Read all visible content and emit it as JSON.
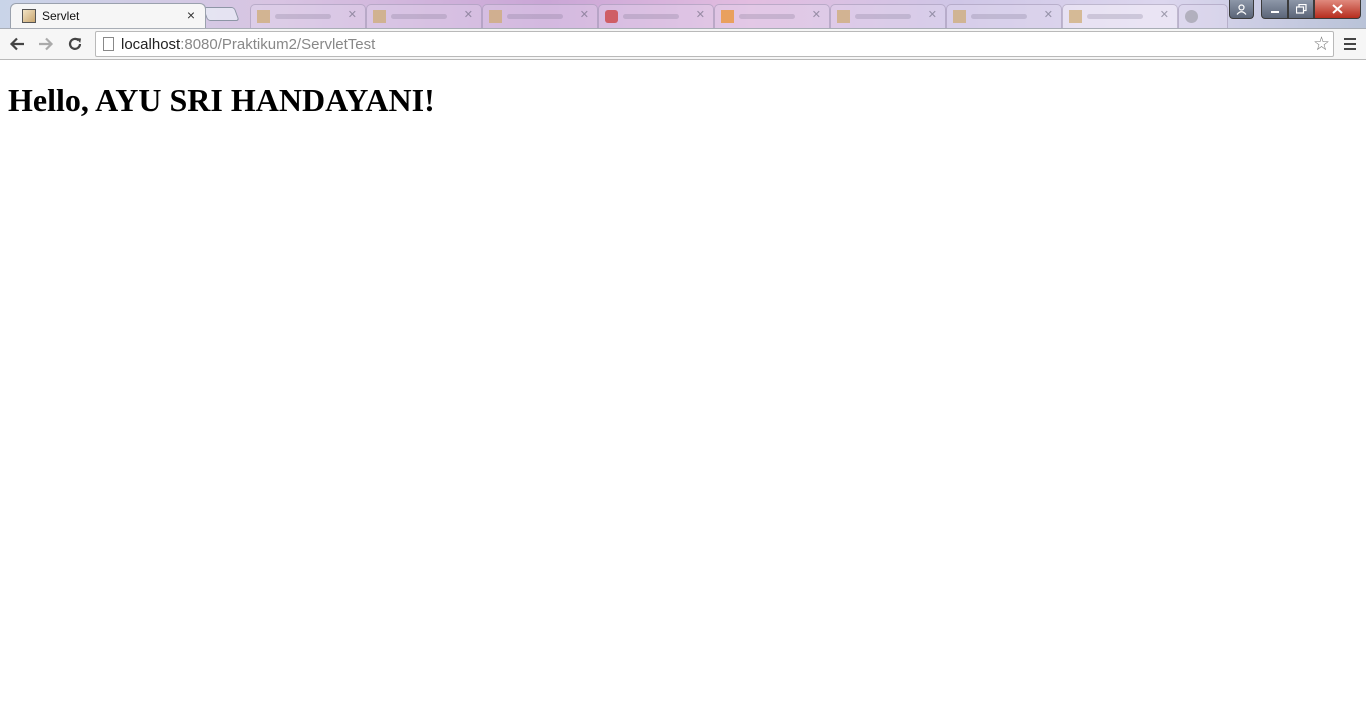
{
  "browser": {
    "active_tab": {
      "title": "Servlet",
      "close_label": "×"
    },
    "address_bar": {
      "host": "localhost",
      "path": ":8080/Praktikum2/ServletTest"
    }
  },
  "icons": {
    "back": "←",
    "forward": "→",
    "reload": "↻",
    "bookmark": "☆",
    "close_window": "✕",
    "minimize": "▁",
    "maximize": "❐",
    "user": "👤"
  },
  "page": {
    "heading": "Hello, AYU SRI HANDAYANI!"
  }
}
